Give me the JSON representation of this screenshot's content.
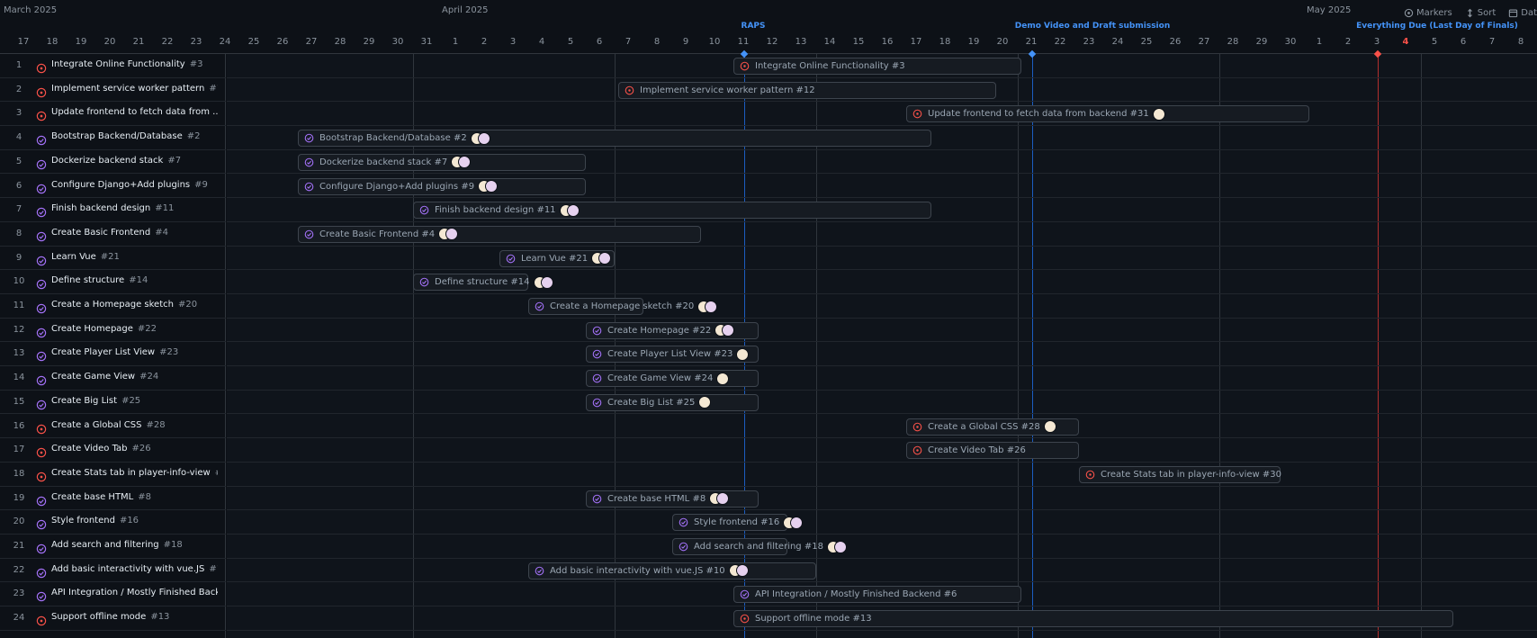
{
  "months": [
    {
      "label": "March 2025"
    },
    {
      "label": "April 2025"
    },
    {
      "label": "May 2025"
    }
  ],
  "markers": [
    {
      "label": "RAPS"
    },
    {
      "label": "Demo Video and Draft submission"
    },
    {
      "label": "Everything Due (Last Day of Finals)"
    }
  ],
  "tools": {
    "markers": "Markers",
    "sort": "Sort",
    "date": "Dat"
  },
  "days": [
    "17",
    "18",
    "19",
    "20",
    "21",
    "22",
    "23",
    "24",
    "25",
    "26",
    "27",
    "28",
    "29",
    "30",
    "31",
    "1",
    "2",
    "3",
    "4",
    "5",
    "6",
    "7",
    "8",
    "9",
    "10",
    "11",
    "12",
    "13",
    "14",
    "15",
    "16",
    "17",
    "18",
    "19",
    "20",
    "21",
    "22",
    "23",
    "24",
    "25",
    "26",
    "27",
    "28",
    "29",
    "30",
    "1",
    "2",
    "3",
    "4",
    "5",
    "6",
    "7",
    "8"
  ],
  "colors": {
    "open": "#f85149",
    "closed": "#a371f7",
    "milestone": "#4493f8",
    "today": "#f85149"
  },
  "items": [
    {
      "n": "1",
      "status": "open",
      "title": "Integrate Online Functionality",
      "num": "#3"
    },
    {
      "n": "2",
      "status": "open",
      "title": "Implement service worker pattern",
      "num": "#12"
    },
    {
      "n": "3",
      "status": "open",
      "title": "Update frontend to fetch data from ...",
      "num": "#31",
      "bar_title": "Update frontend to fetch data from backend"
    },
    {
      "n": "4",
      "status": "closed",
      "title": "Bootstrap Backend/Database",
      "num": "#2"
    },
    {
      "n": "5",
      "status": "closed",
      "title": "Dockerize backend stack",
      "num": "#7"
    },
    {
      "n": "6",
      "status": "closed",
      "title": "Configure Django+Add plugins",
      "num": "#9"
    },
    {
      "n": "7",
      "status": "closed",
      "title": "Finish backend design",
      "num": "#11"
    },
    {
      "n": "8",
      "status": "closed",
      "title": "Create Basic Frontend",
      "num": "#4"
    },
    {
      "n": "9",
      "status": "closed",
      "title": "Learn Vue",
      "num": "#21"
    },
    {
      "n": "10",
      "status": "closed",
      "title": "Define structure",
      "num": "#14"
    },
    {
      "n": "11",
      "status": "closed",
      "title": "Create a Homepage sketch",
      "num": "#20"
    },
    {
      "n": "12",
      "status": "closed",
      "title": "Create Homepage",
      "num": "#22"
    },
    {
      "n": "13",
      "status": "closed",
      "title": "Create Player List View",
      "num": "#23"
    },
    {
      "n": "14",
      "status": "closed",
      "title": "Create Game View",
      "num": "#24"
    },
    {
      "n": "15",
      "status": "closed",
      "title": "Create Big List",
      "num": "#25"
    },
    {
      "n": "16",
      "status": "open",
      "title": "Create a Global CSS",
      "num": "#28"
    },
    {
      "n": "17",
      "status": "open",
      "title": "Create Video Tab",
      "num": "#26"
    },
    {
      "n": "18",
      "status": "open",
      "title": "Create Stats tab in player-info-view",
      "num": "#30"
    },
    {
      "n": "19",
      "status": "closed",
      "title": "Create base HTML",
      "num": "#8"
    },
    {
      "n": "20",
      "status": "closed",
      "title": "Style frontend",
      "num": "#16"
    },
    {
      "n": "21",
      "status": "closed",
      "title": "Add search and filtering",
      "num": "#18"
    },
    {
      "n": "22",
      "status": "closed",
      "title": "Add basic interactivity with vue.JS",
      "num": "#10"
    },
    {
      "n": "23",
      "status": "closed",
      "title": "API Integration / Mostly Finished Back...",
      "num": "#6",
      "bar_title": "API Integration / Mostly Finished Backend"
    },
    {
      "n": "24",
      "status": "open",
      "title": "Support offline mode",
      "num": "#13"
    }
  ]
}
